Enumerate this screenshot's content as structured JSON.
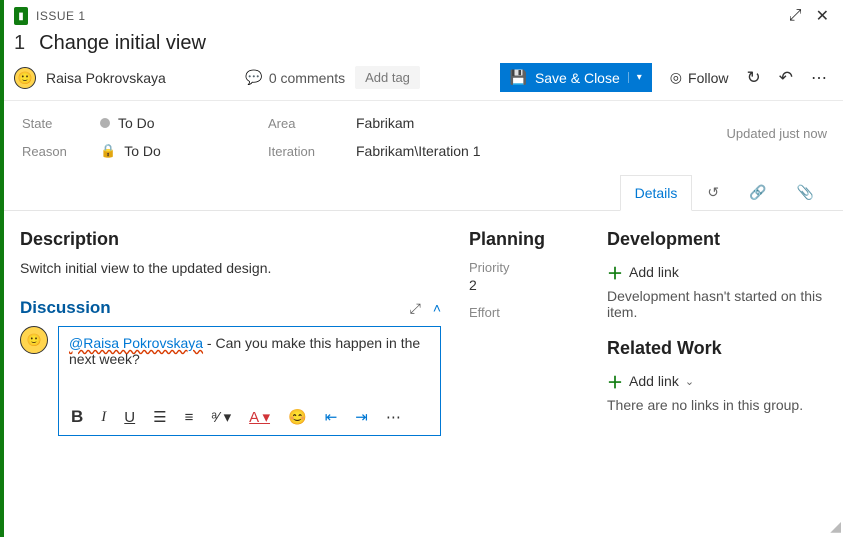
{
  "header": {
    "type": "ISSUE 1",
    "id": "1",
    "title": "Change initial view"
  },
  "toolbar": {
    "assignee": "Raisa Pokrovskaya",
    "comments_count": "0 comments",
    "add_tag": "Add tag",
    "save_close": "Save & Close",
    "follow": "Follow"
  },
  "fields": {
    "state_label": "State",
    "state_value": "To Do",
    "reason_label": "Reason",
    "reason_value": "To Do",
    "area_label": "Area",
    "area_value": "Fabrikam",
    "iteration_label": "Iteration",
    "iteration_value": "Fabrikam\\Iteration 1",
    "updated": "Updated just now"
  },
  "tabs": {
    "details": "Details"
  },
  "description": {
    "heading": "Description",
    "text": "Switch initial view to the updated design."
  },
  "discussion": {
    "heading": "Discussion",
    "mention": "@Raisa Pokrovskaya",
    "text": " - Can you make this happen in the next week?"
  },
  "planning": {
    "heading": "Planning",
    "priority_label": "Priority",
    "priority_value": "2",
    "effort_label": "Effort"
  },
  "development": {
    "heading": "Development",
    "add_link": "Add link",
    "text": "Development hasn't started on this item."
  },
  "related": {
    "heading": "Related Work",
    "add_link": "Add link",
    "text": "There are no links in this group."
  }
}
